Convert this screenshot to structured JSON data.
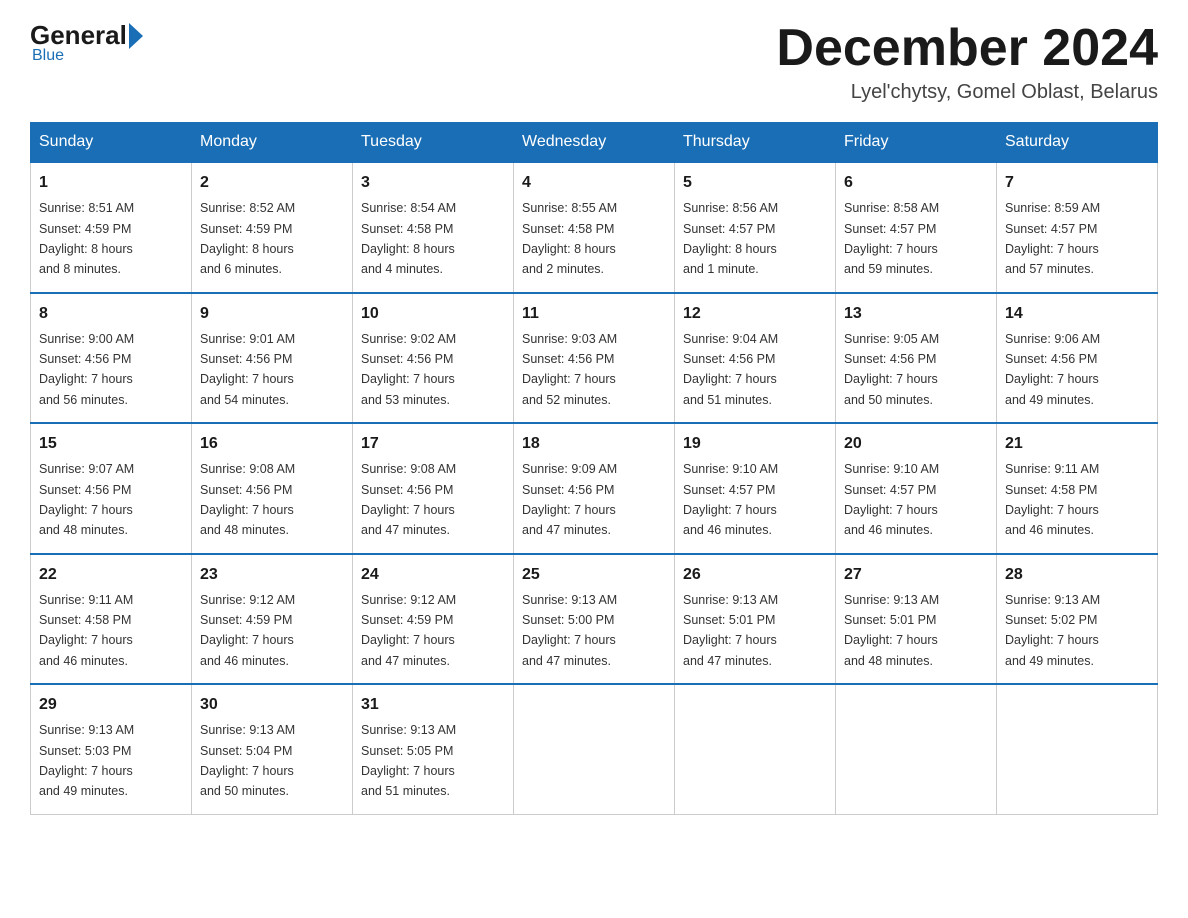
{
  "logo": {
    "general": "General",
    "blue": "Blue",
    "underline": "Blue"
  },
  "header": {
    "title": "December 2024",
    "location": "Lyel'chytsy, Gomel Oblast, Belarus"
  },
  "weekdays": [
    "Sunday",
    "Monday",
    "Tuesday",
    "Wednesday",
    "Thursday",
    "Friday",
    "Saturday"
  ],
  "weeks": [
    [
      {
        "day": "1",
        "sunrise": "8:51 AM",
        "sunset": "4:59 PM",
        "daylight": "8 hours and 8 minutes."
      },
      {
        "day": "2",
        "sunrise": "8:52 AM",
        "sunset": "4:59 PM",
        "daylight": "8 hours and 6 minutes."
      },
      {
        "day": "3",
        "sunrise": "8:54 AM",
        "sunset": "4:58 PM",
        "daylight": "8 hours and 4 minutes."
      },
      {
        "day": "4",
        "sunrise": "8:55 AM",
        "sunset": "4:58 PM",
        "daylight": "8 hours and 2 minutes."
      },
      {
        "day": "5",
        "sunrise": "8:56 AM",
        "sunset": "4:57 PM",
        "daylight": "8 hours and 1 minute."
      },
      {
        "day": "6",
        "sunrise": "8:58 AM",
        "sunset": "4:57 PM",
        "daylight": "7 hours and 59 minutes."
      },
      {
        "day": "7",
        "sunrise": "8:59 AM",
        "sunset": "4:57 PM",
        "daylight": "7 hours and 57 minutes."
      }
    ],
    [
      {
        "day": "8",
        "sunrise": "9:00 AM",
        "sunset": "4:56 PM",
        "daylight": "7 hours and 56 minutes."
      },
      {
        "day": "9",
        "sunrise": "9:01 AM",
        "sunset": "4:56 PM",
        "daylight": "7 hours and 54 minutes."
      },
      {
        "day": "10",
        "sunrise": "9:02 AM",
        "sunset": "4:56 PM",
        "daylight": "7 hours and 53 minutes."
      },
      {
        "day": "11",
        "sunrise": "9:03 AM",
        "sunset": "4:56 PM",
        "daylight": "7 hours and 52 minutes."
      },
      {
        "day": "12",
        "sunrise": "9:04 AM",
        "sunset": "4:56 PM",
        "daylight": "7 hours and 51 minutes."
      },
      {
        "day": "13",
        "sunrise": "9:05 AM",
        "sunset": "4:56 PM",
        "daylight": "7 hours and 50 minutes."
      },
      {
        "day": "14",
        "sunrise": "9:06 AM",
        "sunset": "4:56 PM",
        "daylight": "7 hours and 49 minutes."
      }
    ],
    [
      {
        "day": "15",
        "sunrise": "9:07 AM",
        "sunset": "4:56 PM",
        "daylight": "7 hours and 48 minutes."
      },
      {
        "day": "16",
        "sunrise": "9:08 AM",
        "sunset": "4:56 PM",
        "daylight": "7 hours and 48 minutes."
      },
      {
        "day": "17",
        "sunrise": "9:08 AM",
        "sunset": "4:56 PM",
        "daylight": "7 hours and 47 minutes."
      },
      {
        "day": "18",
        "sunrise": "9:09 AM",
        "sunset": "4:56 PM",
        "daylight": "7 hours and 47 minutes."
      },
      {
        "day": "19",
        "sunrise": "9:10 AM",
        "sunset": "4:57 PM",
        "daylight": "7 hours and 46 minutes."
      },
      {
        "day": "20",
        "sunrise": "9:10 AM",
        "sunset": "4:57 PM",
        "daylight": "7 hours and 46 minutes."
      },
      {
        "day": "21",
        "sunrise": "9:11 AM",
        "sunset": "4:58 PM",
        "daylight": "7 hours and 46 minutes."
      }
    ],
    [
      {
        "day": "22",
        "sunrise": "9:11 AM",
        "sunset": "4:58 PM",
        "daylight": "7 hours and 46 minutes."
      },
      {
        "day": "23",
        "sunrise": "9:12 AM",
        "sunset": "4:59 PM",
        "daylight": "7 hours and 46 minutes."
      },
      {
        "day": "24",
        "sunrise": "9:12 AM",
        "sunset": "4:59 PM",
        "daylight": "7 hours and 47 minutes."
      },
      {
        "day": "25",
        "sunrise": "9:13 AM",
        "sunset": "5:00 PM",
        "daylight": "7 hours and 47 minutes."
      },
      {
        "day": "26",
        "sunrise": "9:13 AM",
        "sunset": "5:01 PM",
        "daylight": "7 hours and 47 minutes."
      },
      {
        "day": "27",
        "sunrise": "9:13 AM",
        "sunset": "5:01 PM",
        "daylight": "7 hours and 48 minutes."
      },
      {
        "day": "28",
        "sunrise": "9:13 AM",
        "sunset": "5:02 PM",
        "daylight": "7 hours and 49 minutes."
      }
    ],
    [
      {
        "day": "29",
        "sunrise": "9:13 AM",
        "sunset": "5:03 PM",
        "daylight": "7 hours and 49 minutes."
      },
      {
        "day": "30",
        "sunrise": "9:13 AM",
        "sunset": "5:04 PM",
        "daylight": "7 hours and 50 minutes."
      },
      {
        "day": "31",
        "sunrise": "9:13 AM",
        "sunset": "5:05 PM",
        "daylight": "7 hours and 51 minutes."
      },
      null,
      null,
      null,
      null
    ]
  ],
  "labels": {
    "sunrise": "Sunrise:",
    "sunset": "Sunset:",
    "daylight": "Daylight:"
  }
}
